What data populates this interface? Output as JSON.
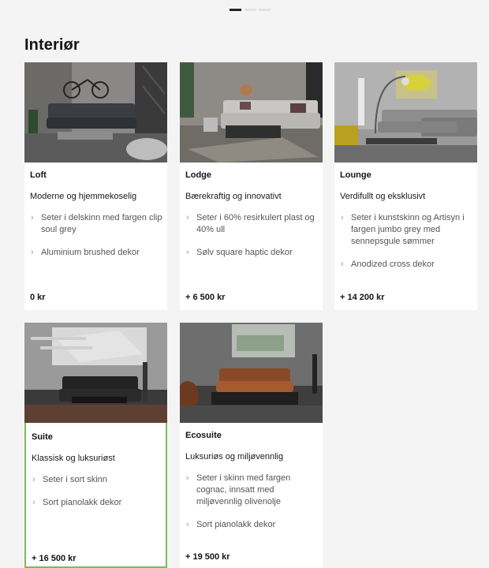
{
  "section_title": "Interiør",
  "pager": {
    "count": 3,
    "active_index": 0
  },
  "cards": [
    {
      "name": "Loft",
      "tagline": "Moderne og hjemmekoselig",
      "features": [
        "Seter i delskinn med fargen clip soul grey",
        "Aluminium brushed dekor"
      ],
      "price": "0 kr",
      "selected": false
    },
    {
      "name": "Lodge",
      "tagline": "Bærekraftig og innovativt",
      "features": [
        "Seter i 60% resirkulert plast og 40% ull",
        "Sølv square haptic dekor"
      ],
      "price": "+ 6 500 kr",
      "selected": false
    },
    {
      "name": "Lounge",
      "tagline": "Verdifullt og eksklusivt",
      "features": [
        "Seter i kunstskinn og Artisyn i fargen jumbo grey med sennepsgule sømmer",
        "Anodized cross dekor"
      ],
      "price": "+ 14 200 kr",
      "selected": false
    },
    {
      "name": "Suite",
      "tagline": "Klassisk og luksuriøst",
      "features": [
        "Seter i sort skinn",
        "Sort pianolakk dekor"
      ],
      "price": "+ 16 500 kr",
      "selected": true
    },
    {
      "name": "Ecosuite",
      "tagline": "Luksuriøs og miljøvennlig",
      "features": [
        "Seter i skinn med fargen cognac, innsatt med miljøvennlig olivenolje",
        "Sort pianolakk dekor"
      ],
      "price": "+ 19 500 kr",
      "selected": false
    }
  ],
  "icons": {
    "feature_bullet": "chevron-right-icon"
  },
  "colors": {
    "selected_border": "#78be5a",
    "background": "#f4f4f4",
    "card": "#ffffff"
  }
}
